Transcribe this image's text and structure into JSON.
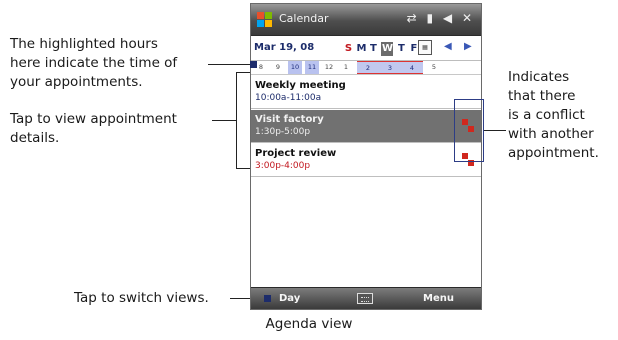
{
  "callouts": {
    "highlighted_hours": [
      "The highlighted hours",
      "here indicate the time of",
      "your appointments."
    ],
    "tap_appointment": [
      "Tap to view appointment",
      "details."
    ],
    "conflict": [
      "Indicates",
      "that there",
      "is a conflict",
      "with another",
      "appointment."
    ],
    "switch_views": "Tap to switch views."
  },
  "caption": "Agenda view",
  "screen": {
    "app_title": "Calendar",
    "status_icons": "⇄ ▮ ◀ ✕",
    "date": "Mar 19, 08",
    "days": [
      "S",
      "M",
      "T",
      "W",
      "T",
      "F",
      "S"
    ],
    "selected_day_index": 3,
    "nav_prev": "◀",
    "nav_next": "▶",
    "hours": [
      "8",
      "9",
      "10",
      "11",
      "12",
      "1",
      "2",
      "3",
      "4",
      "5"
    ],
    "highlighted_hours": [
      "10",
      "11",
      "2",
      "3",
      "4"
    ],
    "appointments": [
      {
        "title": "Weekly meeting",
        "time": "10:00a-11:00a",
        "time_color": "#1d2c6b",
        "selected": false,
        "conflict": false
      },
      {
        "title": "Visit factory",
        "time": "1:30p-5:00p",
        "time_color": "#efefef",
        "selected": true,
        "conflict": true
      },
      {
        "title": "Project review",
        "time": "3:00p-4:00p",
        "time_color": "#c2181f",
        "selected": false,
        "conflict": true
      }
    ],
    "left_softkey": "Day",
    "right_softkey": "Menu"
  },
  "colors": {
    "title_bar": "#4e4e4e",
    "selected_row": "#717171",
    "hour_highlight": "#b9c2ef",
    "conflict": "#d0281e",
    "callout_line": "#222222"
  }
}
